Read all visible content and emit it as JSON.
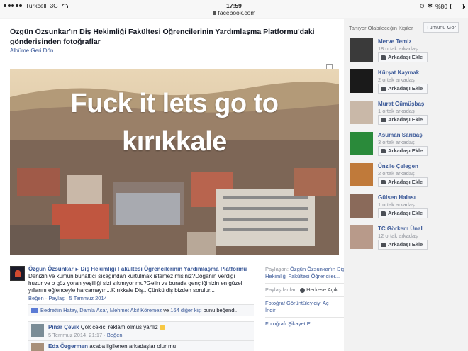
{
  "status_bar": {
    "carrier": "Turkcell",
    "network": "3G",
    "time": "17:59",
    "url": "facebook.com",
    "battery": "%80",
    "battery_level": 0.8
  },
  "album": {
    "title": "Özgün Özsunkar'ın Diş Hekimliği Fakültesi Öğrencilerinin Yardımlaşma Platformu'daki gönderisinden fotoğraflar",
    "back_link": "Albüme Geri Dön"
  },
  "photo": {
    "caption_line1": "Fuck it lets go to",
    "caption_line2": "kırıkkale"
  },
  "post": {
    "author": "Özgün Özsunkar",
    "group": "Diş Hekimliği Fakültesi Öğrencilerinin Yardımlaşma Platformu",
    "body": "Denizin ve kumun bunaltıcı sıcağından kurtulmak istemez misiniz?Doğanın verdiği huzur ve o göz yoran yeşilliği sizi sıkmıyor mu?Gelin ve burada gençliğinizin en güzel yıllarını eğlenceyle harcamayın...Kırıkkale Diş...Çünkü diş bizden sorulur...",
    "like_label": "Beğen",
    "share_label": "Paylaş",
    "date": "5 Temmuz 2014",
    "likes": {
      "people": "Bedrettin Hatay, Damla Acar, Mehmet Akif Köremez",
      "connector": "ve",
      "others": "164 diğer kişi",
      "suffix": "bunu beğendi."
    }
  },
  "comments": [
    {
      "name": "Pınar Çevik",
      "text": "Çok cekici reklam olmus yanliz",
      "date": "5 Temmuz 2014, 21:17",
      "like_label": "Beğen"
    },
    {
      "name": "Eda Özgermen",
      "text": "acaba ilgilenen arkadaşlar olur mu",
      "date": "",
      "like_label": ""
    }
  ],
  "side_panel": {
    "shared_label": "Paylaşan:",
    "shared_by": "Özgün Özsunkar'ın Diş Hekimliği Fakültesi Öğrenciler...",
    "shared_with_label": "Paylaşılanlar:",
    "audience": "Herkese Açık",
    "view_full": "Fotoğraf Görüntüleyiciyi Aç",
    "download": "İndir",
    "report": "Fotoğrafı Şikayet Et"
  },
  "suggestions": {
    "header": "Tanıyor Olabileceğin Kişiler",
    "see_all": "Tümünü Gör",
    "add_label": "Arkadaşı Ekle",
    "people": [
      {
        "name": "Merve Temiz",
        "mutual": "18 ortak arkadaş",
        "avatar_color": "#3a3a3a"
      },
      {
        "name": "Kürşat Kaymak",
        "mutual": "2 ortak arkadaş",
        "avatar_color": "#1a1a1a"
      },
      {
        "name": "Murat Gümüşbaş",
        "mutual": "1 ortak arkadaş",
        "avatar_color": "#c9b8a8"
      },
      {
        "name": "Asuman Sarıbaş",
        "mutual": "3 ortak arkadaş",
        "avatar_color": "#2a8a3a"
      },
      {
        "name": "Ünzile Çelegen",
        "mutual": "2 ortak arkadaş",
        "avatar_color": "#c07a3a"
      },
      {
        "name": "Gülsen Halası",
        "mutual": "1 ortak arkadaş",
        "avatar_color": "#8a6a5a"
      },
      {
        "name": "TC Görkem Ünal",
        "mutual": "12 ortak arkadaş",
        "avatar_color": "#b89a8a"
      }
    ]
  }
}
